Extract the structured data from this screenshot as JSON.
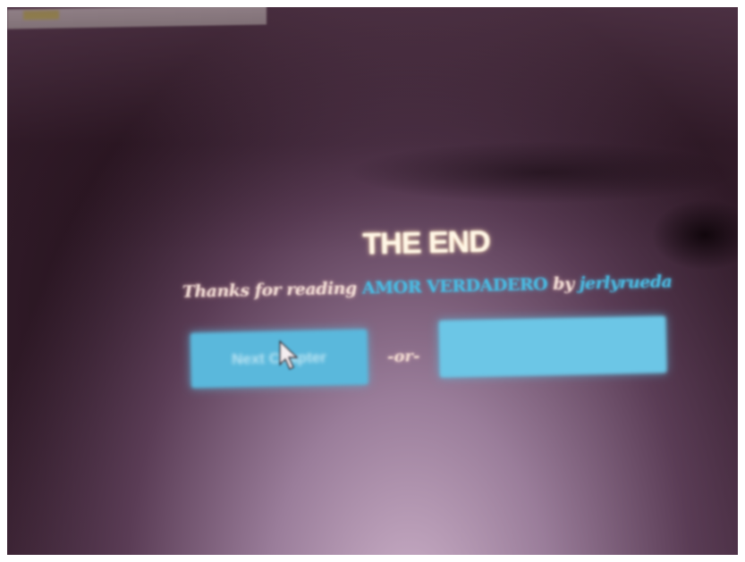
{
  "end_screen": {
    "title": "THE END",
    "thanks_prefix": "Thanks for reading",
    "story_title": "AMOR VERDADERO",
    "by_word": "by",
    "author": "jerlyrueda",
    "divider": "-or-",
    "left_button_label": "Next Chapter",
    "right_button_label": ""
  },
  "colors": {
    "accent": "#5ab8dc",
    "title": "#fff6e6",
    "text": "#f2ddd6",
    "background": "#1a0810"
  },
  "icons": {
    "cursor": "mouse-pointer-icon"
  }
}
